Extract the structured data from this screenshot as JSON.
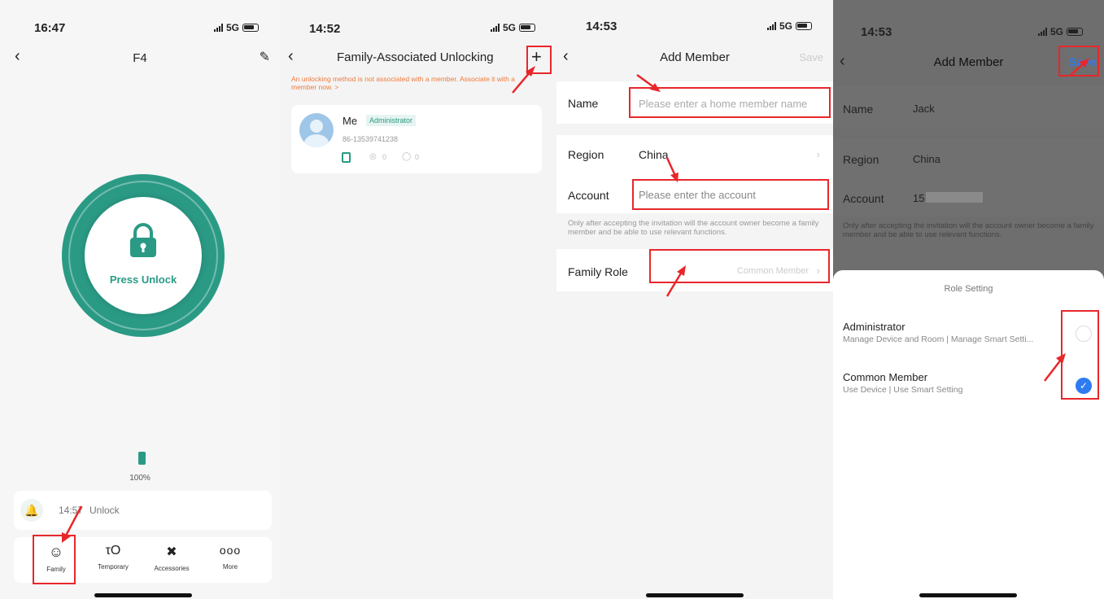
{
  "panel1": {
    "status_time": "16:47",
    "network": "5G",
    "title": "F4",
    "unlock_label": "Press Unlock",
    "battery_level": "100%",
    "log_time": "14:57",
    "log_event": "Unlock",
    "tabs": [
      {
        "label": "Family",
        "icon": "family-icon"
      },
      {
        "label": "Temporary",
        "icon": "key-icon"
      },
      {
        "label": "Accessories",
        "icon": "tools-icon"
      },
      {
        "label": "More",
        "icon": "more-icon"
      }
    ],
    "accent": "#2a9a85"
  },
  "panel2": {
    "status_time": "14:52",
    "network": "5G",
    "title": "Family-Associated Unlocking",
    "warning": "An unlocking method is not associated with a member. Associate it with a member now. >",
    "member_name": "Me",
    "member_role": "Administrator",
    "member_phone": "86-13539741238",
    "count_fingerprint": "0",
    "count_password": "0"
  },
  "panel3": {
    "status_time": "14:53",
    "network": "5G",
    "title": "Add Member",
    "save_label": "Save",
    "name_label": "Name",
    "name_placeholder": "Please enter a home member name",
    "region_label": "Region",
    "region_value": "China",
    "account_label": "Account",
    "account_placeholder": "Please enter the account",
    "notice": "Only after accepting the invitation will the account owner become a family member and be able to use relevant functions.",
    "role_label": "Family Role",
    "role_value": "Common Member"
  },
  "panel4": {
    "status_time": "14:53",
    "network": "5G",
    "title": "Add Member",
    "save_label": "Save",
    "name_label": "Name",
    "name_value": "Jack",
    "region_label": "Region",
    "region_value": "China",
    "account_label": "Account",
    "account_value": "15",
    "notice": "Only after accepting the invitation will the account owner become a family member and be able to use relevant functions.",
    "sheet_title": "Role Setting",
    "options": [
      {
        "title": "Administrator",
        "desc": "Manage Device and Room | Manage Smart Setti...",
        "selected": false
      },
      {
        "title": "Common Member",
        "desc": "Use Device | Use Smart Setting",
        "selected": true
      }
    ],
    "check_color": "#2f7bf0"
  }
}
